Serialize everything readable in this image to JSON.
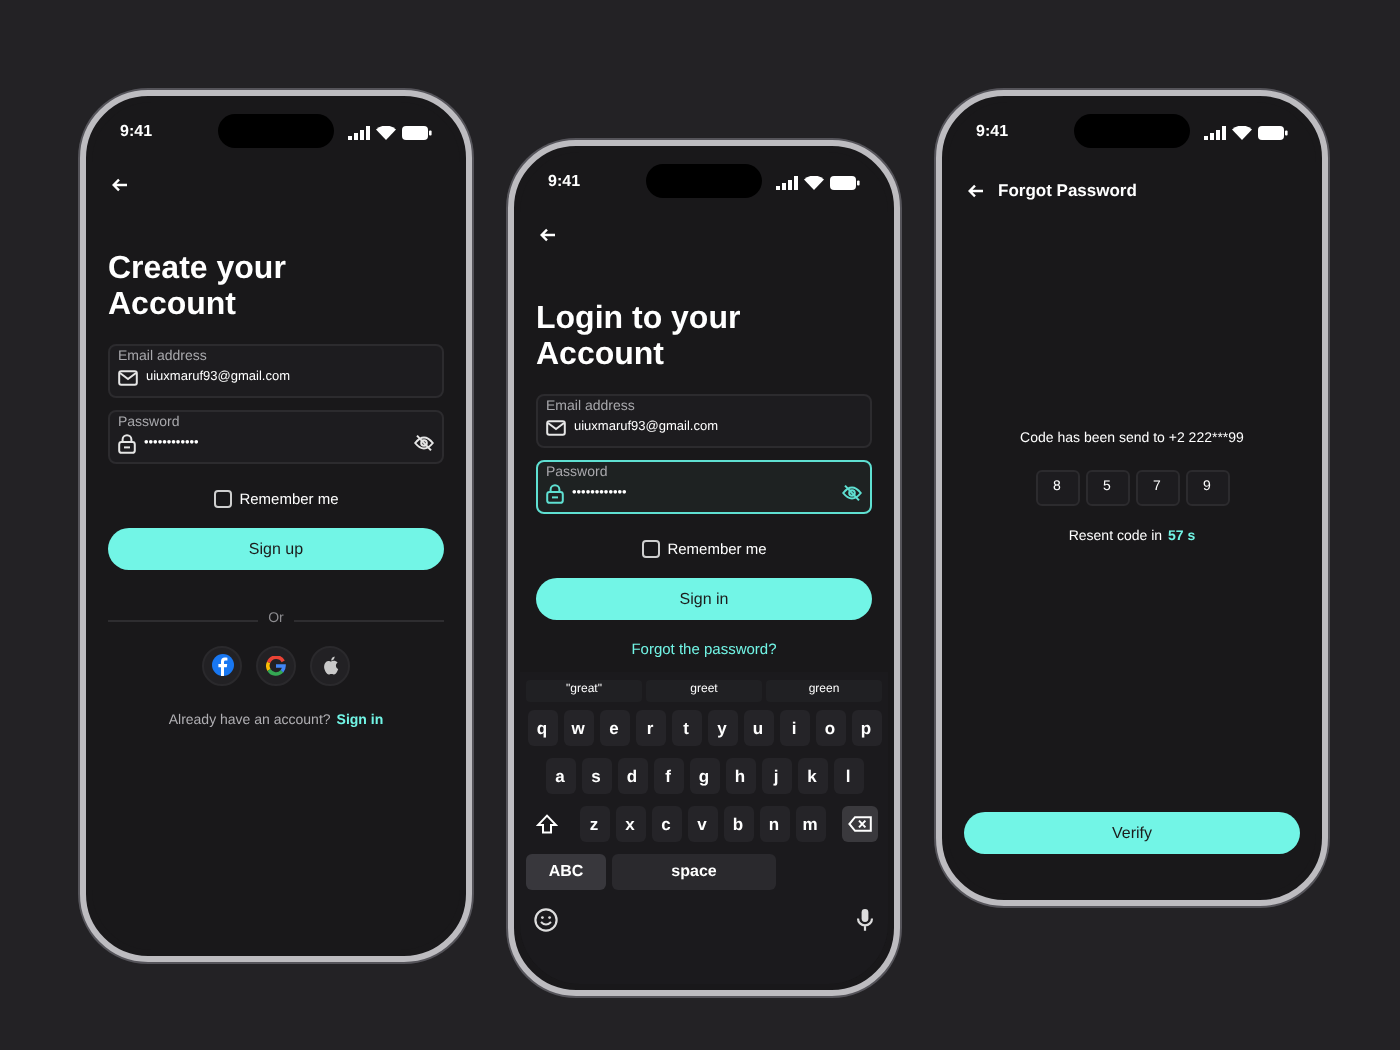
{
  "screens": [
    {
      "kind": "signup",
      "time": "9:41",
      "title": "Create your Account",
      "fields": [
        {
          "kind": "email",
          "label": "Email address",
          "value": "uiuxmaruf93@gmail.com",
          "focused": false
        },
        {
          "kind": "password",
          "label": "Password",
          "value": "••••••••••••",
          "focused": false
        }
      ],
      "remember": {
        "label": "Remember me",
        "checked": false
      },
      "button": "Sign up",
      "divider": "Or",
      "social": [
        {
          "kind": "facebook"
        },
        {
          "kind": "google"
        },
        {
          "kind": "apple"
        }
      ],
      "footer_text": "Already have an account?",
      "footer_link": "Sign in"
    },
    {
      "kind": "login",
      "time": "9:41",
      "title": "Login to your Account",
      "fields": [
        {
          "kind": "email",
          "label": "Email address",
          "value": "uiuxmaruf93@gmail.com",
          "focused": false
        },
        {
          "kind": "password",
          "label": "Password",
          "value": "••••••••••••",
          "focused": true
        }
      ],
      "remember": {
        "label": "Remember me",
        "checked": false
      },
      "button": "Sign in",
      "forgot_link": "Forgot the password?",
      "keyboard": {
        "suggestions": [
          "\"great\"",
          "greet",
          "green"
        ],
        "rows": [
          [
            "q",
            "w",
            "e",
            "r",
            "t",
            "y",
            "u",
            "i",
            "o",
            "p"
          ],
          [
            "a",
            "s",
            "d",
            "f",
            "g",
            "h",
            "j",
            "k",
            "l"
          ],
          [
            "z",
            "x",
            "c",
            "v",
            "b",
            "n",
            "m"
          ]
        ],
        "mode_key": "ABC",
        "space_key": "space"
      }
    },
    {
      "kind": "otp",
      "time": "9:41",
      "header": "Forgot Password",
      "message": "Code has been send to +2 222***99",
      "digits": [
        "8",
        "5",
        "7",
        "9"
      ],
      "resend_text": "Resent code in",
      "resend_time": "57 s",
      "button": "Verify"
    }
  ]
}
